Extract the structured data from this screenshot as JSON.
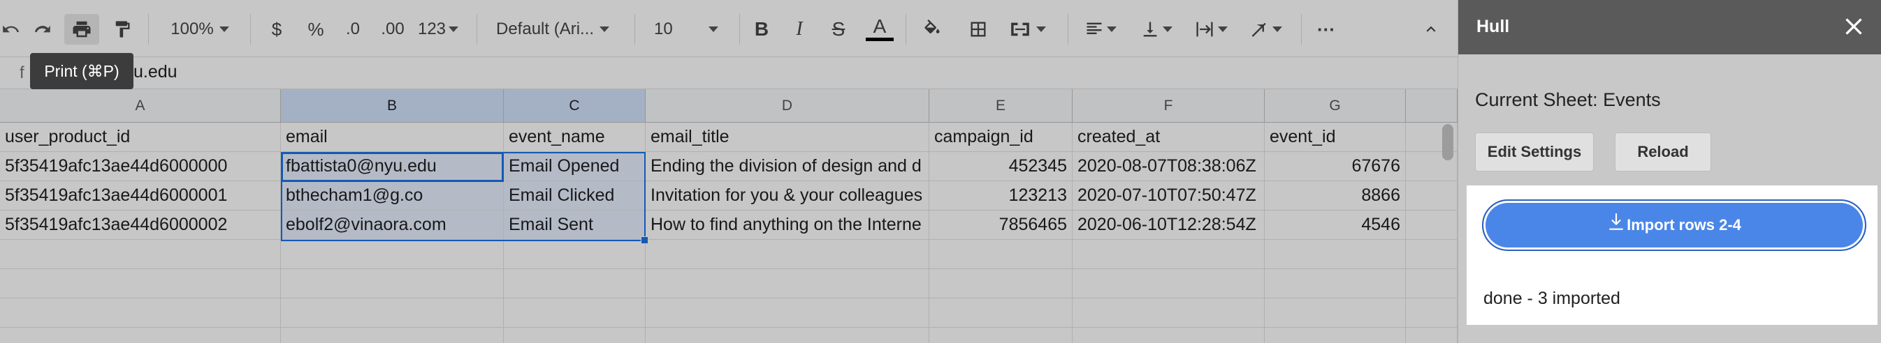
{
  "toolbar": {
    "zoom": "100%",
    "currency": "$",
    "percent": "%",
    "dec_decrease": ".0",
    "dec_increase": ".00",
    "more_formats": "123",
    "font": "Default (Ari...",
    "font_size": "10",
    "text_color_accent": "#000000",
    "more": "···"
  },
  "tooltip": "Print (⌘P)",
  "formula_bar": {
    "fx": "f",
    "value": "u.edu"
  },
  "columns": [
    "A",
    "B",
    "C",
    "D",
    "E",
    "F",
    "G"
  ],
  "headers": [
    "user_product_id",
    "email",
    "event_name",
    "email_title",
    "campaign_id",
    "created_at",
    "event_id"
  ],
  "rows": [
    [
      "5f35419afc13ae44d6000000",
      "fbattista0@nyu.edu",
      "Email Opened",
      "Ending the division of design and d",
      "452345",
      "2020-08-07T08:38:06Z",
      "67676"
    ],
    [
      "5f35419afc13ae44d6000001",
      "bthecham1@g.co",
      "Email Clicked",
      "Invitation for you & your colleagues",
      "123213",
      "2020-07-10T07:50:47Z",
      "8866"
    ],
    [
      "5f35419afc13ae44d6000002",
      "ebolf2@vinaora.com",
      "Email Sent",
      "How to find anything on the Interne",
      "7856465",
      "2020-06-10T12:28:54Z",
      "4546"
    ]
  ],
  "sidebar": {
    "title": "Hull",
    "current_sheet": "Current Sheet: Events",
    "edit_settings": "Edit Settings",
    "reload": "Reload",
    "import_button": "Import rows 2-4",
    "status": "done - 3 imported",
    "accent": "#4a86e8"
  }
}
